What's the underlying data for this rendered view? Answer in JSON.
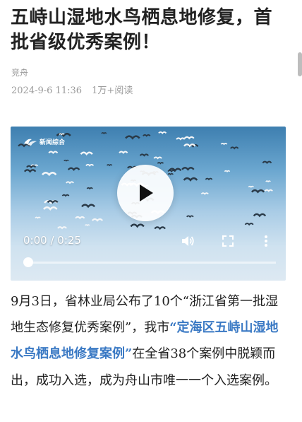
{
  "article": {
    "title": "五峙山湿地水鸟栖息地修复，首批省级优秀案例！",
    "author": "竞舟",
    "date": "2024-9-6 11:36",
    "reads": "1万+阅读"
  },
  "video": {
    "logo_text": "新闻综合",
    "time": "0:00 / 0:25",
    "progress": 0,
    "play_icon": "play-icon",
    "volume_icon": "volume-icon",
    "fullscreen_icon": "fullscreen-icon",
    "more_icon": "more-vertical-icon"
  },
  "body": {
    "p1_a": "9月3日，省林业局公布了10个“浙江省第一批湿地生态修复优秀案例”，我市",
    "p1_highlight": "“定海区五峙山湿地水鸟栖息地修复案例”",
    "p1_b": "在全省38个案例中脱颖而出，成功入选，成为舟山市唯一一个入选案例。"
  },
  "colors": {
    "highlight": "#3a79c4",
    "meta_gray": "#9a9a9a",
    "title": "#222222"
  }
}
